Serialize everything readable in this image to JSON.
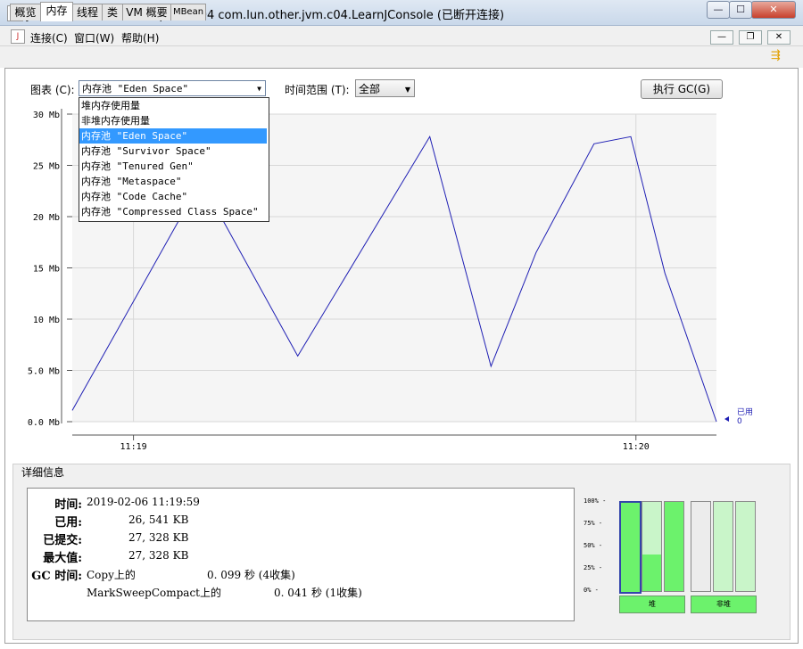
{
  "window": {
    "title": "Java 监视和管理控制台 - pid: 7504 com.lun.other.jvm.c04.LearnJConsole (已断开连接)",
    "app_icon": "java-cup-icon",
    "minimize": "—",
    "maximize": "☐",
    "close": "✕"
  },
  "menu": {
    "items": [
      "连接(C)",
      "窗口(W)",
      "帮助(H)"
    ],
    "inner_min": "—",
    "inner_restore": "❐",
    "inner_close": "✕"
  },
  "tabs": [
    "概览",
    "内存",
    "线程",
    "类",
    "VM 概要",
    "MBean"
  ],
  "active_tab": "内存",
  "controls": {
    "chart_label": "图表 (C):",
    "chart_value": "内存池 \"Eden Space\"",
    "range_label": "时间范围 (T):",
    "range_value": "全部",
    "gc_button": "执行 GC(G)"
  },
  "chart_options": [
    "堆内存使用量",
    "非堆内存使用量",
    "内存池 \"Eden Space\"",
    "内存池 \"Survivor Space\"",
    "内存池 \"Tenured Gen\"",
    "内存池 \"Metaspace\"",
    "内存池 \"Code Cache\"",
    "内存池 \"Compressed Class Space\""
  ],
  "selected_option_index": 2,
  "chart_data": {
    "type": "line",
    "ylim": [
      0,
      30
    ],
    "yticks": [
      "0.0 Mb",
      "5.0 Mb",
      "10 Mb",
      "15 Mb",
      "20 Mb",
      "25 Mb",
      "30 Mb"
    ],
    "ytick_values": [
      0,
      5,
      10,
      15,
      20,
      25,
      30
    ],
    "xticks": [
      "11:19",
      "11:20"
    ],
    "xtick_positions": [
      0.095,
      0.875
    ],
    "series": [
      {
        "name": "已用",
        "color": "#1f1fb4",
        "x": [
          0.0,
          0.2,
          0.35,
          0.555,
          0.65,
          0.72,
          0.81,
          0.867,
          0.92,
          1.0
        ],
        "y": [
          1.1,
          23.5,
          6.4,
          27.8,
          5.4,
          16.5,
          27.1,
          27.8,
          14.5,
          0.0
        ]
      }
    ],
    "legend_label": "已用",
    "legend_value": "0",
    "grid": true
  },
  "details": {
    "section_title": "详细信息",
    "time_label": "时间:",
    "time_value": "2019-02-06 11:19:59",
    "used_label": "已用:",
    "used_value": "26, 541 KB",
    "committed_label": "已提交:",
    "committed_value": "27, 328 KB",
    "max_label": "最大值:",
    "max_value": "27, 328 KB",
    "gc_label": "GC 时间:",
    "gc_rows": [
      {
        "name": "Copy上的",
        "value": "0. 099  秒 (4收集)"
      },
      {
        "name": "MarkSweepCompact上的",
        "value": "0. 041  秒 (1收集)"
      }
    ]
  },
  "gauges": {
    "yticks": [
      "100%",
      "75%",
      "50%",
      "25%",
      "0%"
    ],
    "heap": [
      {
        "name": "heap-gauge-eden",
        "fill": 1.0,
        "selected": true
      },
      {
        "name": "heap-gauge-survivor",
        "fill": 0.41,
        "selected": false
      },
      {
        "name": "heap-gauge-tenured",
        "fill": 1.0,
        "selected": false
      }
    ],
    "nonheap": [
      {
        "name": "nonheap-gauge-metaspace",
        "fill": 0.0
      },
      {
        "name": "nonheap-gauge-code-cache",
        "fill": 0.0
      },
      {
        "name": "nonheap-gauge-class-space",
        "fill": 0.0
      }
    ],
    "heap_label": "堆",
    "nonheap_label": "非堆",
    "colors": {
      "used": "#6cf26c",
      "committed": "#c9f5c9",
      "empty": "#ececec"
    }
  }
}
